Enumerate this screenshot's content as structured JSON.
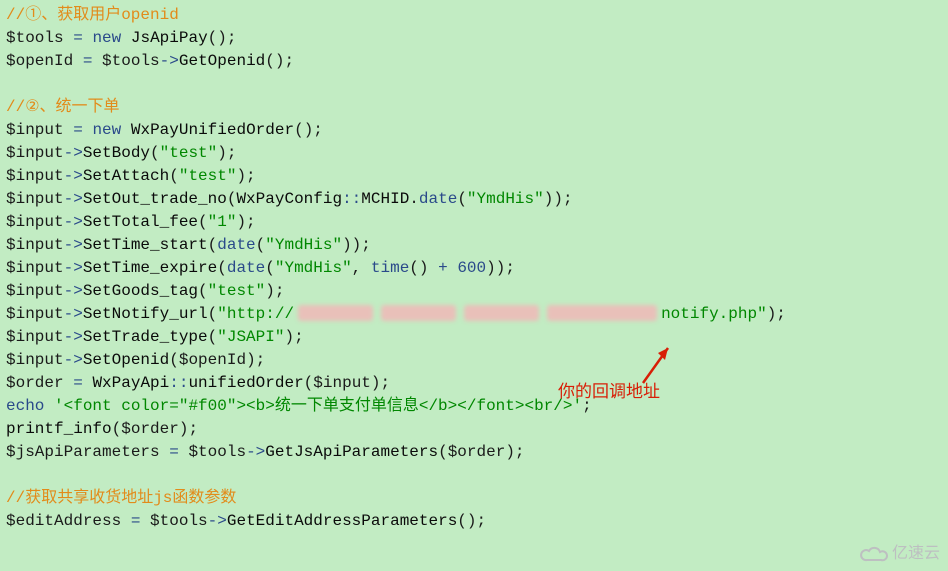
{
  "code": {
    "c1": "//①、获取用户openid",
    "l2_var1": "$tools",
    "l2_kw": "new",
    "l2_fn": "JsApiPay",
    "l3_var1": "$openId",
    "l3_var2": "$tools",
    "l3_fn": "GetOpenid",
    "c4": "//②、统一下单",
    "l5_var": "$input",
    "l5_kw": "new",
    "l5_fn": "WxPayUnifiedOrder",
    "l6_var": "$input",
    "l6_fn": "SetBody",
    "l6_str": "\"test\"",
    "l7_var": "$input",
    "l7_fn": "SetAttach",
    "l7_str": "\"test\"",
    "l8_var": "$input",
    "l8_fn": "SetOut_trade_no",
    "l8_cls": "WxPayConfig",
    "l8_const": "MCHID",
    "l8_datefn": "date",
    "l8_str": "\"YmdHis\"",
    "l9_var": "$input",
    "l9_fn": "SetTotal_fee",
    "l9_str": "\"1\"",
    "l10_var": "$input",
    "l10_fn": "SetTime_start",
    "l10_datefn": "date",
    "l10_str": "\"YmdHis\"",
    "l11_var": "$input",
    "l11_fn": "SetTime_expire",
    "l11_datefn": "date",
    "l11_str": "\"YmdHis\"",
    "l11_timefn": "time",
    "l11_num": "600",
    "l12_var": "$input",
    "l12_fn": "SetGoods_tag",
    "l12_str": "\"test\"",
    "l13_var": "$input",
    "l13_fn": "SetNotify_url",
    "l13_str_a": "\"http://",
    "l13_str_b": "notify.php\"",
    "l14_var": "$input",
    "l14_fn": "SetTrade_type",
    "l14_str": "\"JSAPI\"",
    "l15_var": "$input",
    "l15_fn": "SetOpenid",
    "l15_arg": "$openId",
    "l16_var": "$order",
    "l16_cls": "WxPayApi",
    "l16_fn": "unifiedOrder",
    "l16_arg": "$input",
    "l17_kw": "echo",
    "l17_str": "'<font color=\"#f00\"><b>统一下单支付单信息</b></font><br/>'",
    "l18_fn": "printf_info",
    "l18_arg": "$order",
    "l19_var": "$jsApiParameters",
    "l19_var2": "$tools",
    "l19_fn": "GetJsApiParameters",
    "l19_arg": "$order",
    "c20": "//获取共享收货地址js函数参数",
    "l21_var": "$editAddress",
    "l21_var2": "$tools",
    "l21_fn": "GetEditAddressParameters"
  },
  "annotation": "你的回调地址",
  "watermark": "亿速云"
}
